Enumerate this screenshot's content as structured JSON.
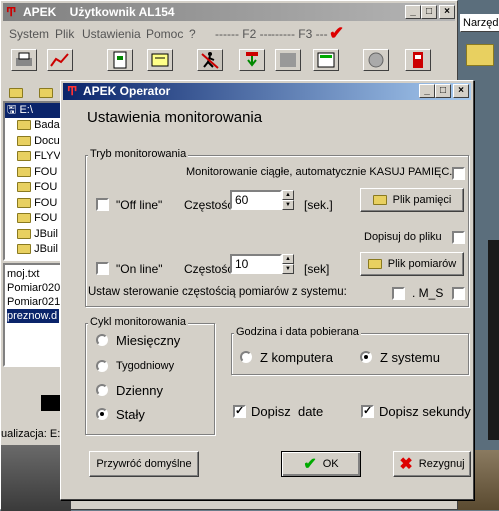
{
  "main_window": {
    "title": "APEK    Użytkownik AL154",
    "menu": [
      "System",
      "Plik",
      "Ustawienia",
      "Pomoc",
      "?",
      "------ F2 ---",
      "------ F3 ---"
    ]
  },
  "explorer": {
    "tree_root": "E:\\",
    "folders": [
      "Bada",
      "Docu",
      "FLYV",
      "FOU",
      "FOU",
      "FOU",
      "FOU",
      "JBuil",
      "JBuil"
    ],
    "files": [
      "moj.txt",
      "Pomiar020",
      "Pomiar021",
      "preznow.d"
    ],
    "status": "ualizacja: E:\\"
  },
  "right_panel": {
    "label": "Narzędzia"
  },
  "dialog": {
    "title": "APEK Operator",
    "heading": "Ustawienia monitorowania",
    "tryb": {
      "legend": "Tryb monitorowania",
      "continuous_label": "Monitorowanie ciągłe, automatycznie KASUJ PAMIĘC.",
      "offline_label": "\"Off line\"",
      "offline_freq_label": "Częstość",
      "offline_freq_value": "60",
      "offline_unit": "[sek.]",
      "memory_file_button": "Plik pamięci",
      "append_label": "Dopisuj do pliku",
      "online_label": "\"On line\"",
      "online_freq_label": "Częstość",
      "online_freq_value": "10",
      "online_unit": "[sek]",
      "measure_file_button": "Plik pomiarów",
      "system_control_label": "Ustaw sterowanie częstością pomiarów  z systemu:",
      "ms_label": ". M_S"
    },
    "cycle": {
      "legend": "Cykl monitorowania",
      "options": [
        "Miesięczny",
        "Tygodniowy",
        "Dzienny",
        "Stały"
      ],
      "selected": "Stały"
    },
    "datetime": {
      "legend": "Godzina i data pobierana",
      "from_computer": "Z komputera",
      "from_system": "Z systemu",
      "selected": "Z systemu"
    },
    "append_date": "Dopisz  date",
    "append_seconds": "Dopisz sekundy",
    "restore_button": "Przywróć domyślne",
    "ok_button": "OK",
    "cancel_button": "Rezygnuj"
  }
}
